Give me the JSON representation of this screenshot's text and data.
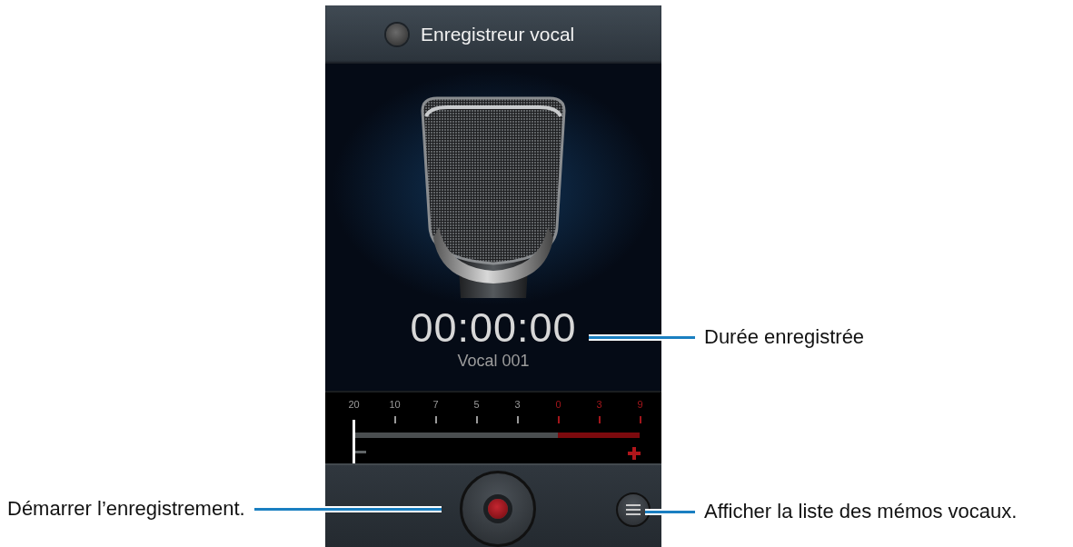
{
  "title_bar": {
    "title": "Enregistreur vocal"
  },
  "recording": {
    "duration": "00:00:00",
    "name": "Vocal 001"
  },
  "meter": {
    "scale": [
      {
        "label": "20",
        "color": "#9a9a9a"
      },
      {
        "label": "10",
        "color": "#9a9a9a"
      },
      {
        "label": "7",
        "color": "#9a9a9a"
      },
      {
        "label": "5",
        "color": "#9a9a9a"
      },
      {
        "label": "3",
        "color": "#9a9a9a"
      },
      {
        "label": "0",
        "color": "#a3161b"
      },
      {
        "label": "3",
        "color": "#a3161b"
      },
      {
        "label": "9",
        "color": "#a3161b"
      }
    ],
    "level": 0
  },
  "callouts": [
    {
      "text": "Durée enregistrée"
    },
    {
      "text": "Démarrer l’enregistrement."
    },
    {
      "text": "Afficher la liste des mémos vocaux."
    }
  ]
}
